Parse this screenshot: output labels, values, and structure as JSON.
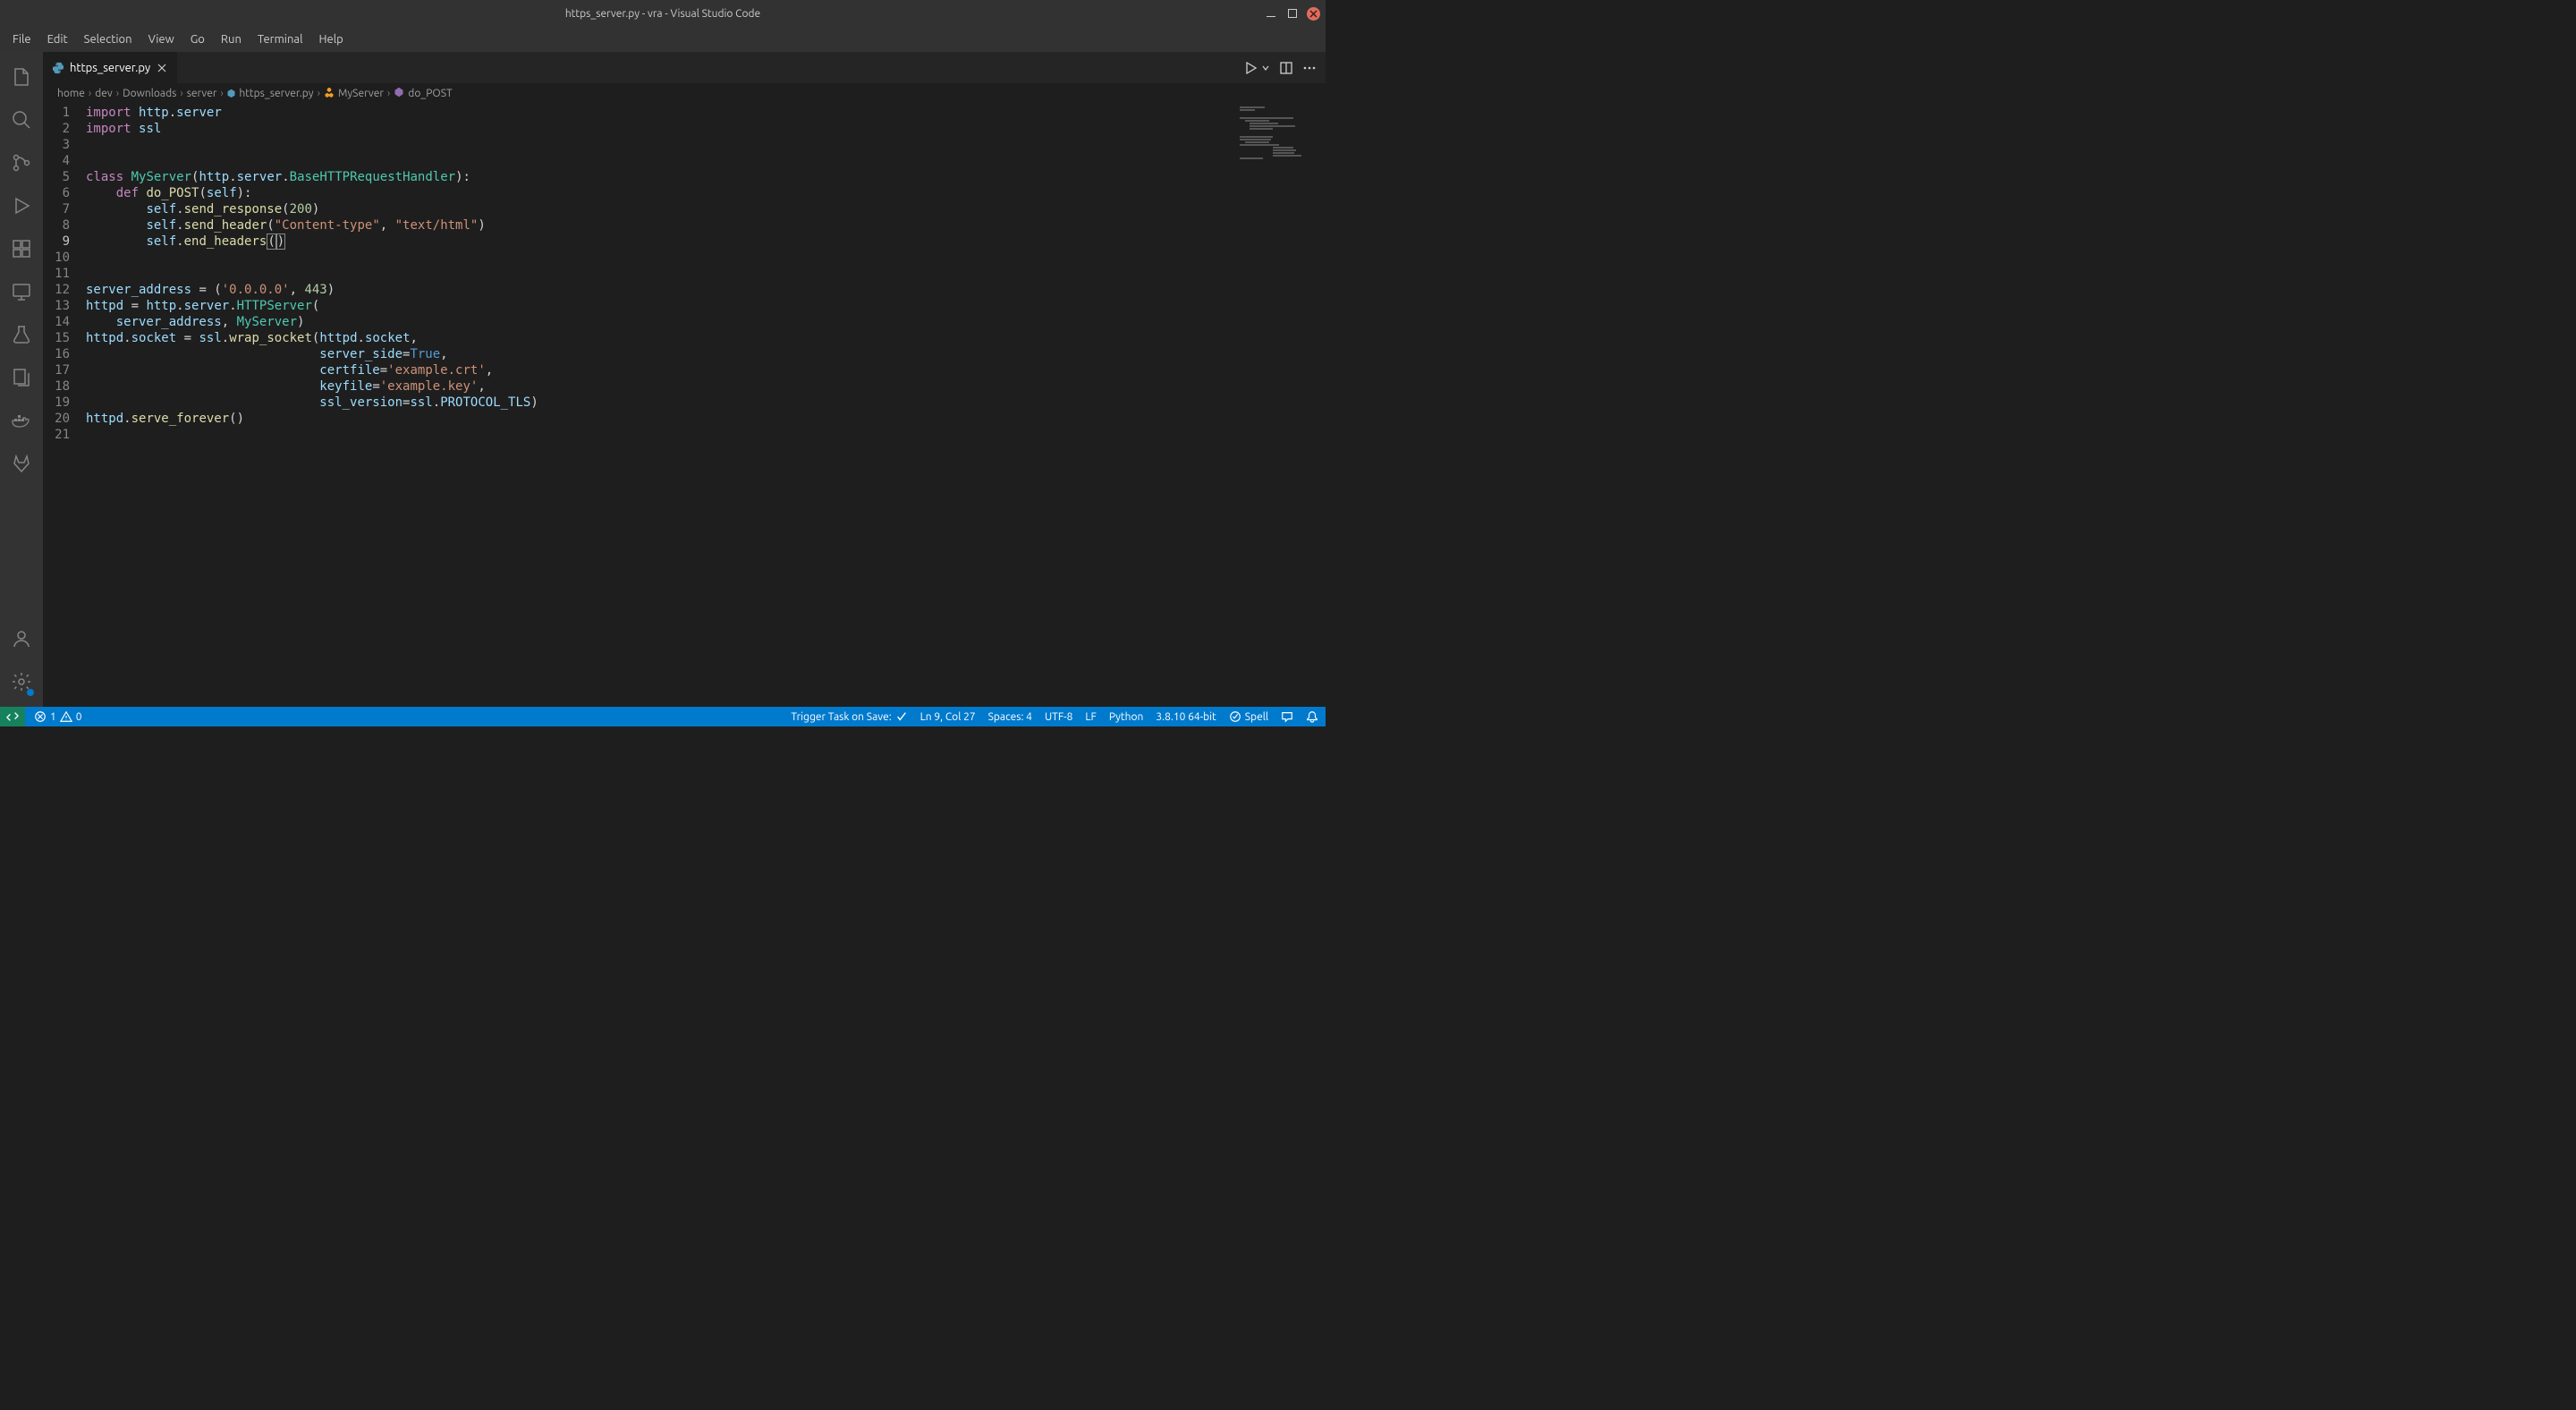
{
  "window": {
    "title": "https_server.py - vra - Visual Studio Code"
  },
  "menu": [
    "File",
    "Edit",
    "Selection",
    "View",
    "Go",
    "Run",
    "Terminal",
    "Help"
  ],
  "tab": {
    "filename": "https_server.py"
  },
  "breadcrumb": {
    "items": [
      "home",
      "dev",
      "Downloads",
      "server",
      "https_server.py",
      "MyServer",
      "do_POST"
    ]
  },
  "lines": [
    "import http.server",
    "import ssl",
    "",
    "",
    "class MyServer(http.server.BaseHTTPRequestHandler):",
    "    def do_POST(self):",
    "        self.send_response(200)",
    "        self.send_header(\"Content-type\", \"text/html\")",
    "        self.end_headers()",
    "",
    "",
    "server_address = ('0.0.0.0', 443)",
    "httpd = http.server.HTTPServer(",
    "    server_address, MyServer)",
    "httpd.socket = ssl.wrap_socket(httpd.socket,",
    "                               server_side=True,",
    "                               certfile='example.crt',",
    "                               keyfile='example.key',",
    "                               ssl_version=ssl.PROTOCOL_TLS)",
    "httpd.serve_forever()",
    ""
  ],
  "line_count": 21,
  "current_line": 9,
  "status": {
    "errors": "1",
    "warnings": "0",
    "trigger": "Trigger Task on Save:",
    "cursor": "Ln 9, Col 27",
    "spaces": "Spaces: 4",
    "encoding": "UTF-8",
    "eol": "LF",
    "language": "Python",
    "interpreter": "3.8.10 64-bit",
    "spell": "Spell"
  }
}
